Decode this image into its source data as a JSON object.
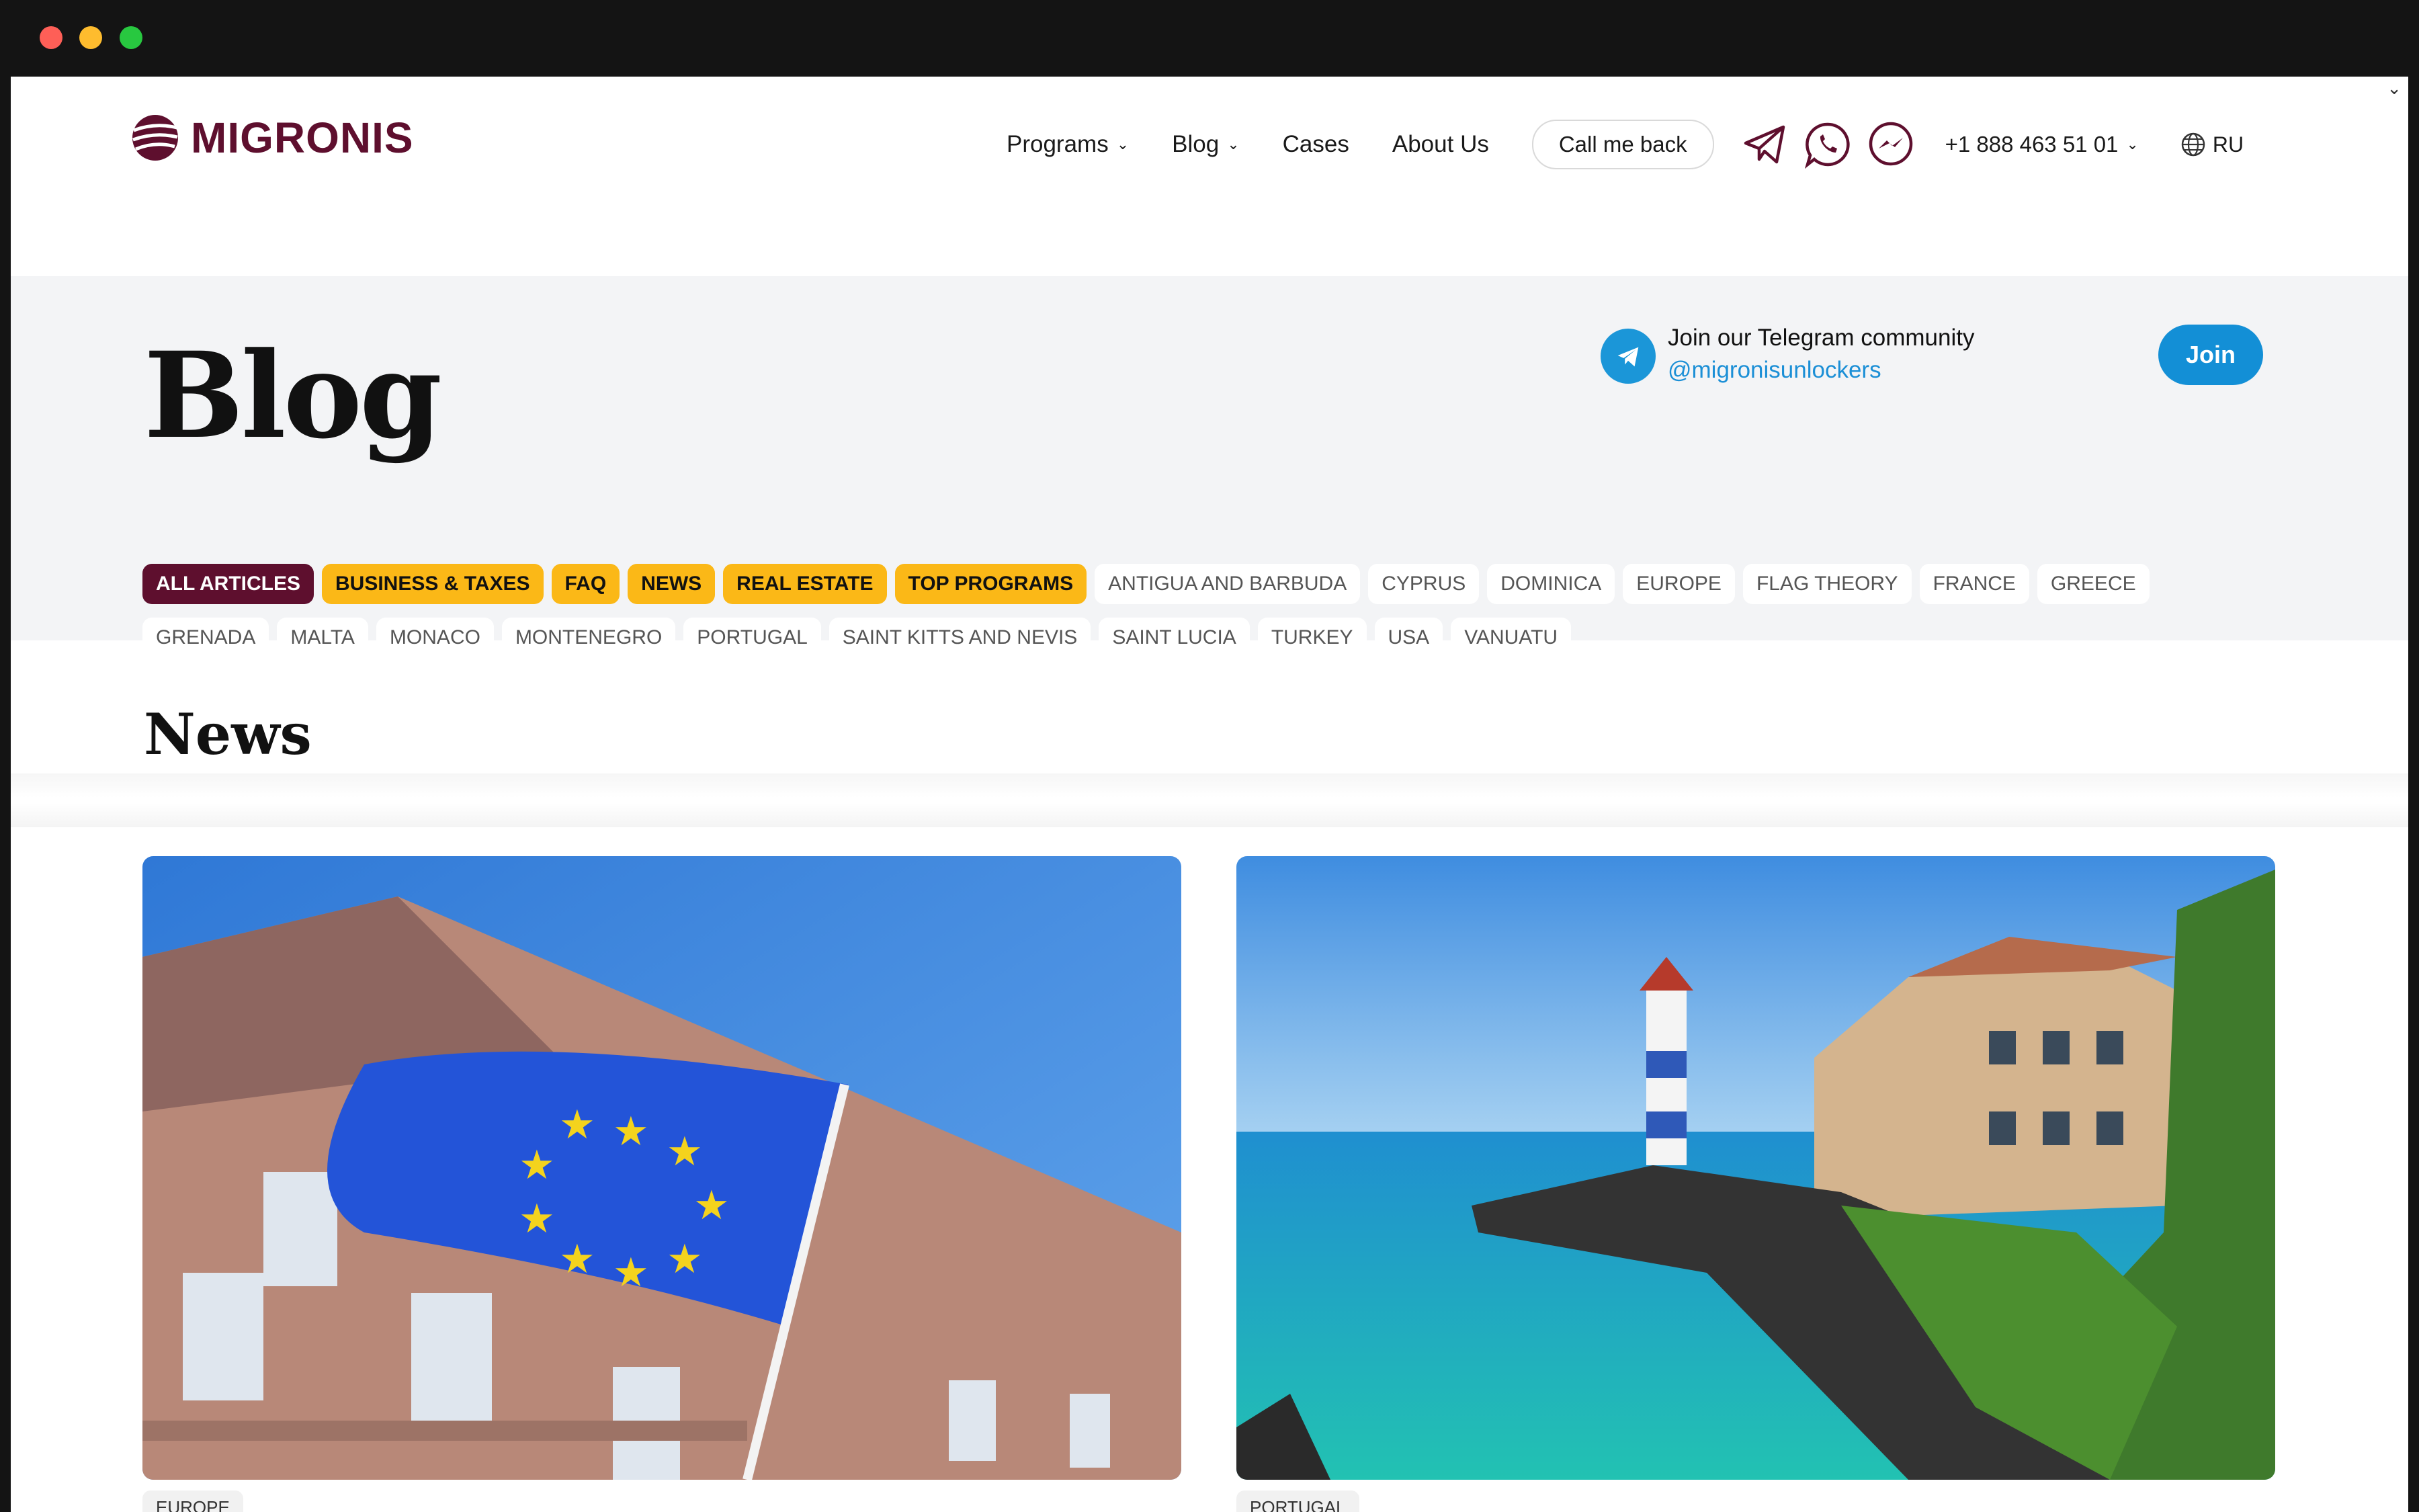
{
  "header": {
    "logo_text": "MIGRONIS",
    "nav": [
      {
        "label": "Programs",
        "has_dropdown": true
      },
      {
        "label": "Blog",
        "has_dropdown": true
      },
      {
        "label": "Cases",
        "has_dropdown": false
      },
      {
        "label": "About Us",
        "has_dropdown": false
      }
    ],
    "callback_label": "Call me back",
    "social_icons": [
      "telegram-icon",
      "whatsapp-icon",
      "messenger-icon"
    ],
    "phone": "+1 888 463 51 01",
    "language": "RU"
  },
  "hero": {
    "title": "Blog",
    "telegram": {
      "line1": "Join our Telegram community",
      "handle": "@migronisunlockers",
      "join_label": "Join"
    },
    "tags": [
      {
        "label": "ALL ARTICLES",
        "style": "active"
      },
      {
        "label": "BUSINESS & TAXES",
        "style": "highlight"
      },
      {
        "label": "FAQ",
        "style": "highlight"
      },
      {
        "label": "NEWS",
        "style": "highlight"
      },
      {
        "label": "REAL ESTATE",
        "style": "highlight"
      },
      {
        "label": "TOP PROGRAMS",
        "style": "highlight"
      },
      {
        "label": "ANTIGUA AND BARBUDA",
        "style": "default"
      },
      {
        "label": "CYPRUS",
        "style": "default"
      },
      {
        "label": "DOMINICA",
        "style": "default"
      },
      {
        "label": "EUROPE",
        "style": "default"
      },
      {
        "label": "FLAG THEORY",
        "style": "default"
      },
      {
        "label": "FRANCE",
        "style": "default"
      },
      {
        "label": "GREECE",
        "style": "default"
      },
      {
        "label": "GRENADA",
        "style": "default"
      },
      {
        "label": "MALTA",
        "style": "default"
      },
      {
        "label": "MONACO",
        "style": "default"
      },
      {
        "label": "MONTENEGRO",
        "style": "default"
      },
      {
        "label": "PORTUGAL",
        "style": "default"
      },
      {
        "label": "SAINT KITTS AND NEVIS",
        "style": "default"
      },
      {
        "label": "SAINT LUCIA",
        "style": "default"
      },
      {
        "label": "TURKEY",
        "style": "default"
      },
      {
        "label": "USA",
        "style": "default"
      },
      {
        "label": "VANUATU",
        "style": "default"
      }
    ]
  },
  "news": {
    "title": "News",
    "cards": [
      {
        "tag": "EUROPE"
      },
      {
        "tag": "PORTUGAL"
      }
    ]
  },
  "colors": {
    "brand": "#5e0f2e",
    "highlight": "#fbb817",
    "telegram_blue": "#138fd6"
  }
}
